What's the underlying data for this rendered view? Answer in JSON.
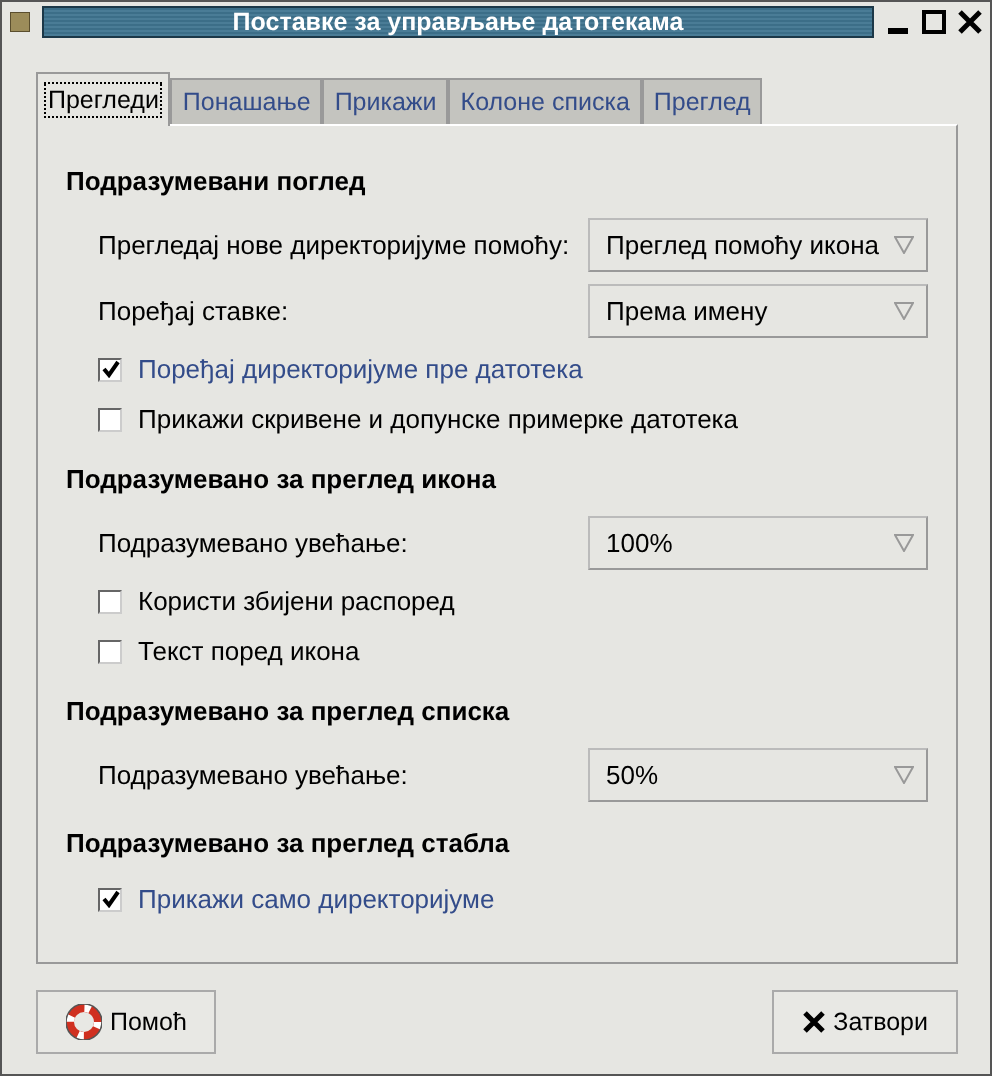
{
  "window": {
    "title": "Поставке за управљање датотекама"
  },
  "tabs": [
    {
      "label": "Прегледи",
      "selected": true
    },
    {
      "label": "Понашање",
      "selected": false
    },
    {
      "label": "Прикажи",
      "selected": false
    },
    {
      "label": "Колоне списка",
      "selected": false
    },
    {
      "label": "Преглед",
      "selected": false
    }
  ],
  "sections": [
    {
      "heading": "Подразумевани поглед",
      "rows": [
        {
          "kind": "dropdown",
          "label": "Прегледај нове директоријуме помоћу:",
          "value": "Преглед помоћу икона"
        },
        {
          "kind": "dropdown",
          "label": "Поређај ставке:",
          "value": "Према имену"
        },
        {
          "kind": "checkbox",
          "label": "Поређај директоријуме пре датотека",
          "checked": true
        },
        {
          "kind": "checkbox",
          "label": "Прикажи скривене и допунске примерке датотека",
          "checked": false
        }
      ]
    },
    {
      "heading": "Подразумевано за преглед икона",
      "rows": [
        {
          "kind": "dropdown",
          "label": "Подразумевано увећање:",
          "value": "100%"
        },
        {
          "kind": "checkbox",
          "label": "Користи збијени распоред",
          "checked": false
        },
        {
          "kind": "checkbox",
          "label": "Текст поред икона",
          "checked": false
        }
      ]
    },
    {
      "heading": "Подразумевано за преглед списка",
      "rows": [
        {
          "kind": "dropdown",
          "label": "Подразумевано увећање:",
          "value": "50%"
        }
      ]
    },
    {
      "heading": "Подразумевано за преглед стабла",
      "rows": [
        {
          "kind": "checkbox",
          "label": "Прикажи само директоријуме",
          "checked": true
        }
      ]
    }
  ],
  "buttons": [
    {
      "kind": "help",
      "label": "Помоћ"
    },
    {
      "kind": "close",
      "label": "Затвори"
    }
  ]
}
